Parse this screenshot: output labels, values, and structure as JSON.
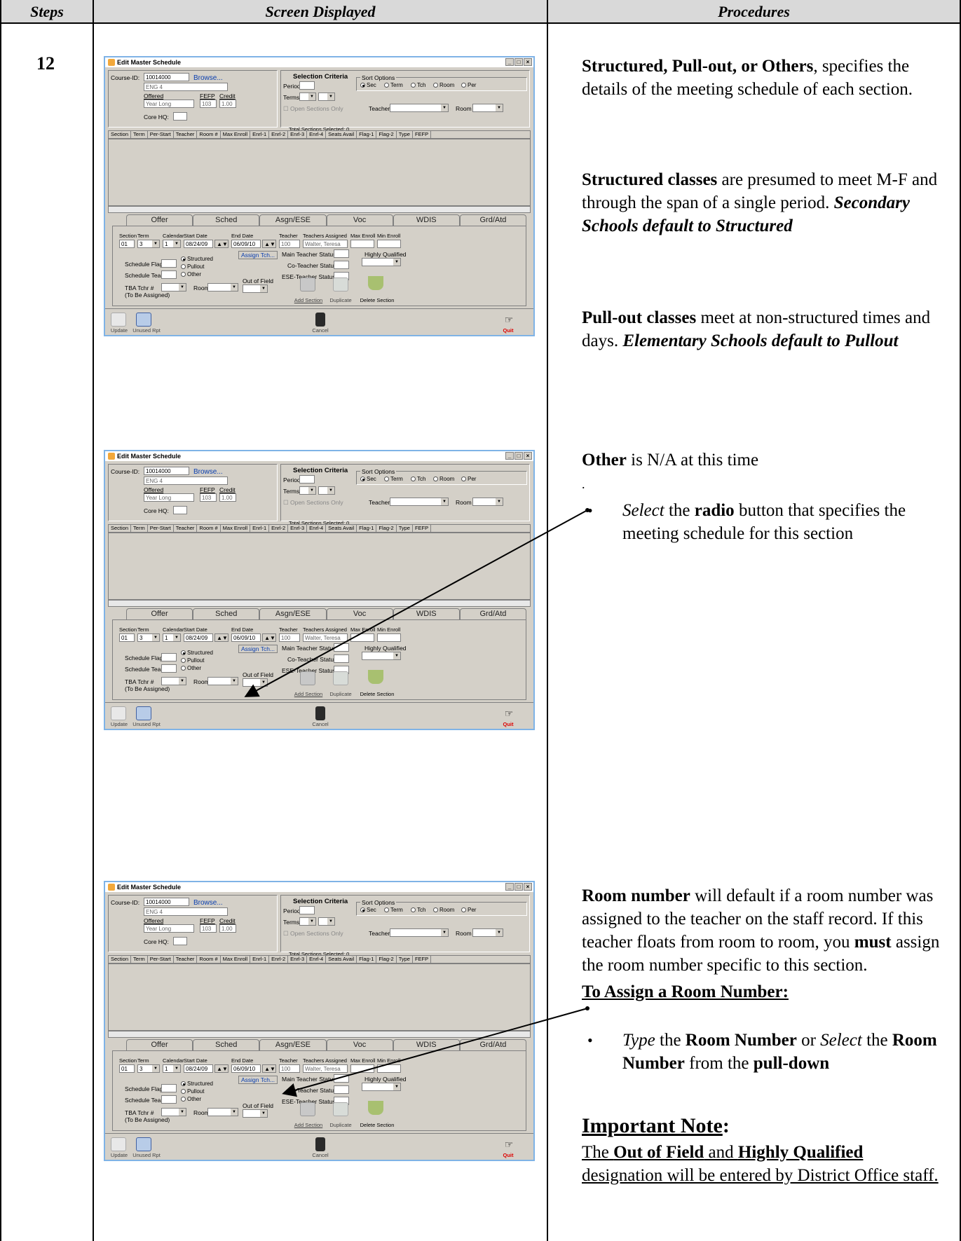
{
  "header": {
    "steps": "Steps",
    "screen": "Screen Displayed",
    "procedures": "Procedures"
  },
  "step_number": "12",
  "window": {
    "title": "Edit Master Schedule",
    "course_id_label": "Course-ID:",
    "course_id": "10014000",
    "browse": "Browse...",
    "course_name": "ENG 4",
    "offered_label": "Offered",
    "offered_value": "Year Long",
    "fefp_label": "FEFP",
    "fefp_value": "103",
    "credit_label": "Credit",
    "credit_value": "1.00",
    "core_hq_label": "Core HQ:",
    "selection_criteria": "Selection Criteria",
    "period_label": "Period",
    "terms_label": "Terms",
    "open_sections": "Open Sections Only",
    "sort_options": "Sort Options",
    "sort_sec": "Sec",
    "sort_term": "Term",
    "sort_tch": "Tch",
    "sort_room": "Room",
    "sort_per": "Per",
    "teacher_label": "Teacher",
    "room_label": "Room",
    "total_sections": "Total Sections Selected: 0",
    "columns": [
      "Section",
      "Term",
      "Per-Start",
      "Teacher",
      "Room #",
      "Max Enroll",
      "Enrl-1",
      "Enrl-2",
      "Enrl-3",
      "Enrl-4",
      "Seats Avail",
      "Flag-1",
      "Flag-2",
      "Type",
      "FEFP"
    ],
    "tabs": [
      "Offer",
      "Sched",
      "Asgn/ESE",
      "Voc",
      "WDIS",
      "Grd/Atd"
    ],
    "section_label": "Section",
    "section_value": "01",
    "term_label": "Term",
    "term_value": "3",
    "calendar_label": "Calendar",
    "calendar_value": "1",
    "start_date_label": "Start Date",
    "start_date": "08/24/09",
    "end_date_label": "End Date",
    "end_date": "06/09/10",
    "teacher_col": "Teacher",
    "teacher_num": "100",
    "teachers_assigned_label": "Teachers Assigned",
    "teachers_assigned": "Walter, Teresa",
    "max_enroll_label": "Max Enroll",
    "min_enroll_label": "Min Enroll",
    "assign_tch": "Assign Tch...",
    "main_teacher_status": "Main Teacher Status",
    "co_teacher_status": "Co-Teacher Status",
    "ese_teacher_status": "ESE-Teacher Status",
    "highly_qualified": "Highly Qualified",
    "schedule_flag": "Schedule Flag",
    "schedule_team": "Schedule Team",
    "structured": "Structured",
    "pullout": "Pullout",
    "other": "Other",
    "out_of_field": "Out of Field",
    "tba_tchr": "TBA Tchr #",
    "tba_sub": "(To Be Assigned)",
    "room": "Room",
    "add_section": "Add Section",
    "duplicate": "Duplicate",
    "delete_section": "Delete Section",
    "update": "Update",
    "unused_rpt": "Unused Rpt",
    "cancel": "Cancel",
    "quit": "Quit"
  },
  "procedures": {
    "p1_bold": "Structured, Pull-out, or Others",
    "p1_rest": ", specifies the details of the meeting schedule of each section.",
    "p2_bold": "Structured classes",
    "p2_rest": " are presumed to meet M-F and through the span of a single period. ",
    "p2_bi": "Secondary Schools default to Structured",
    "p3_bold": "Pull-out classes",
    "p3_rest": " meet at non-structured times and days. ",
    "p3_bi": "Elementary Schools default to Pullout",
    "p4_bold": "Other",
    "p4_rest": " is N/A at this time",
    "p4_dot": ".",
    "b1_i": "Select",
    "b1_a": " the ",
    "b1_b": "radio",
    "b1_c": " button that specifies the meeting schedule for this section",
    "p5_bold": "Room number",
    "p5_rest": " will default if a room number was assigned to the teacher on the staff record. If this teacher floats from room to room, you ",
    "p5_must": "must",
    "p5_end": " assign the room number specific to this section.",
    "assign_heading": "To Assign a Room Number:",
    "b2_i1": "Type",
    "b2_a": " the ",
    "b2_b1": "Room Number",
    "b2_c": " or ",
    "b2_i2": "Select",
    "b2_d": " the ",
    "b2_b2": "Room Number",
    "b2_e": " from the ",
    "b2_b3": "pull-down",
    "note_heading": "Important Note",
    "note_colon": ":",
    "note_a": "The ",
    "note_b1": "Out of Field",
    "note_c": " and ",
    "note_b2": "Highly Qualified",
    "note_d": " designation will be entered by District Office staff."
  }
}
